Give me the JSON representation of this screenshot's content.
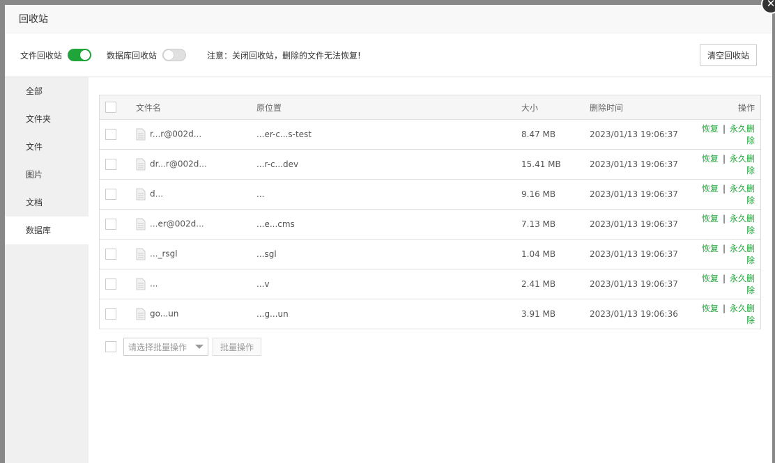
{
  "dialog": {
    "title": "回收站",
    "close_glyph": "✕"
  },
  "toolbar": {
    "file_recycle_label": "文件回收站",
    "file_recycle_on": true,
    "db_recycle_label": "数据库回收站",
    "db_recycle_on": false,
    "notice": "注意：关闭回收站，删除的文件无法恢复!",
    "clear_label": "清空回收站"
  },
  "sidebar": {
    "items": [
      {
        "label": "全部"
      },
      {
        "label": "文件夹"
      },
      {
        "label": "文件"
      },
      {
        "label": "图片"
      },
      {
        "label": "文档"
      },
      {
        "label": "数据库"
      }
    ],
    "active_index": 5
  },
  "table": {
    "headers": {
      "name": "文件名",
      "path": "原位置",
      "size": "大小",
      "time": "删除时间",
      "ops": "操作"
    },
    "rows": [
      {
        "name": "r...r@002d...",
        "path": "...er-c...s-test",
        "size": "8.47 MB",
        "time": "2023/01/13 19:06:37"
      },
      {
        "name": "dr...r@002d...",
        "path": "...r-c...dev",
        "size": "15.41 MB",
        "time": "2023/01/13 19:06:37"
      },
      {
        "name": "d...",
        "path": "...",
        "size": "9.16 MB",
        "time": "2023/01/13 19:06:37"
      },
      {
        "name": "...er@002d...",
        "path": "...e...cms",
        "size": "7.13 MB",
        "time": "2023/01/13 19:06:37"
      },
      {
        "name": "..._rsgl",
        "path": "...sgl",
        "size": "1.04 MB",
        "time": "2023/01/13 19:06:37"
      },
      {
        "name": "...",
        "path": "...v",
        "size": "2.41 MB",
        "time": "2023/01/13 19:06:37"
      },
      {
        "name": "go...un",
        "path": "...g...un",
        "size": "3.91 MB",
        "time": "2023/01/13 19:06:36"
      }
    ],
    "restore_label": "恢复",
    "separator": "|",
    "delete_label": "永久删除"
  },
  "batch": {
    "select_placeholder": "请选择批量操作",
    "button_label": "批量操作"
  },
  "colors": {
    "accent": "#20a53a",
    "sidebar_bg": "#f0f0f0",
    "header_bg": "#f6f6f6"
  },
  "icons": {
    "file": "file-icon",
    "close": "close-icon",
    "caret": "chevron-down-icon"
  }
}
